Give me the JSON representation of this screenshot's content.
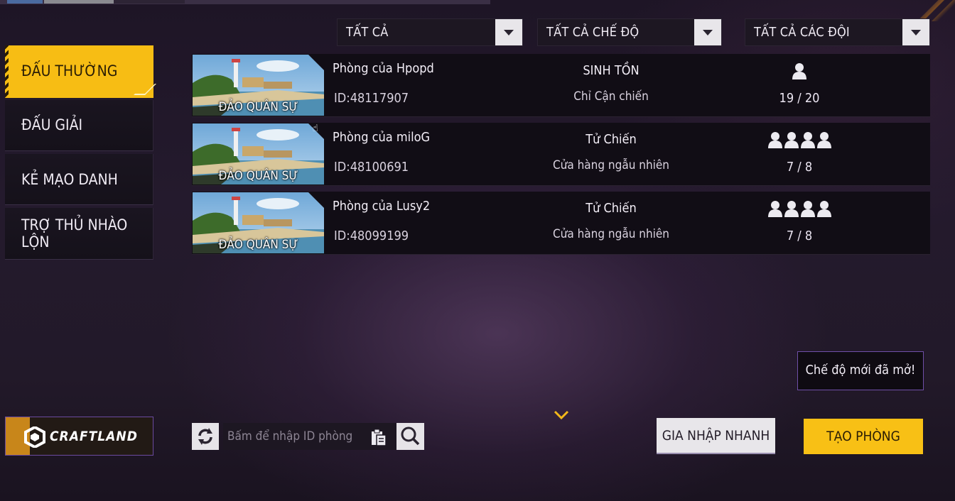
{
  "filters": {
    "all": "TẤT CẢ",
    "all_modes": "TẤT CẢ CHẾ ĐỘ",
    "all_teams": "TẤT CẢ CÁC ĐỘI"
  },
  "sidebar": {
    "items": [
      {
        "label": "ĐẤU THƯỜNG",
        "active": true
      },
      {
        "label": "ĐẤU GIẢI",
        "active": false
      },
      {
        "label": "KẺ MẠO DANH",
        "active": false
      },
      {
        "label": "TRỢ THỦ NHÀO LỘN",
        "active": false
      }
    ]
  },
  "rooms": [
    {
      "map": "ĐẢO QUÂN SỰ",
      "name": "Phòng của Hpopd",
      "id": "ID:48117907",
      "mode": "SINH TỒN",
      "submode": "Chỉ Cận chiến",
      "player_icons": 1,
      "count": "19 / 20"
    },
    {
      "map": "ĐẢO QUÂN SỰ",
      "name": "Phòng của miloG",
      "id": "ID:48100691",
      "mode": "Tử Chiến",
      "submode": "Cửa hàng ngẫu nhiên",
      "player_icons": 4,
      "count": "7 / 8"
    },
    {
      "map": "ĐẢO QUÂN SỰ",
      "name": "Phòng của Lusy2",
      "id": "ID:48099199",
      "mode": "Tử Chiến",
      "submode": "Cửa hàng ngẫu nhiên",
      "player_icons": 4,
      "count": "7 / 8"
    }
  ],
  "craftland": {
    "label": "CRAFTLAND",
    "icon": "craftland-logo-icon"
  },
  "search": {
    "placeholder": "Bấm để nhập ID phòng",
    "value": ""
  },
  "buttons": {
    "quick_join": "GIA NHẬP NHANH",
    "create_room": "TẠO PHÒNG"
  },
  "notice": "Chế độ mới đã mở!",
  "colors": {
    "accent": "#f7bd14",
    "panel": "#110d15",
    "border_purple": "#6f4fa8"
  }
}
